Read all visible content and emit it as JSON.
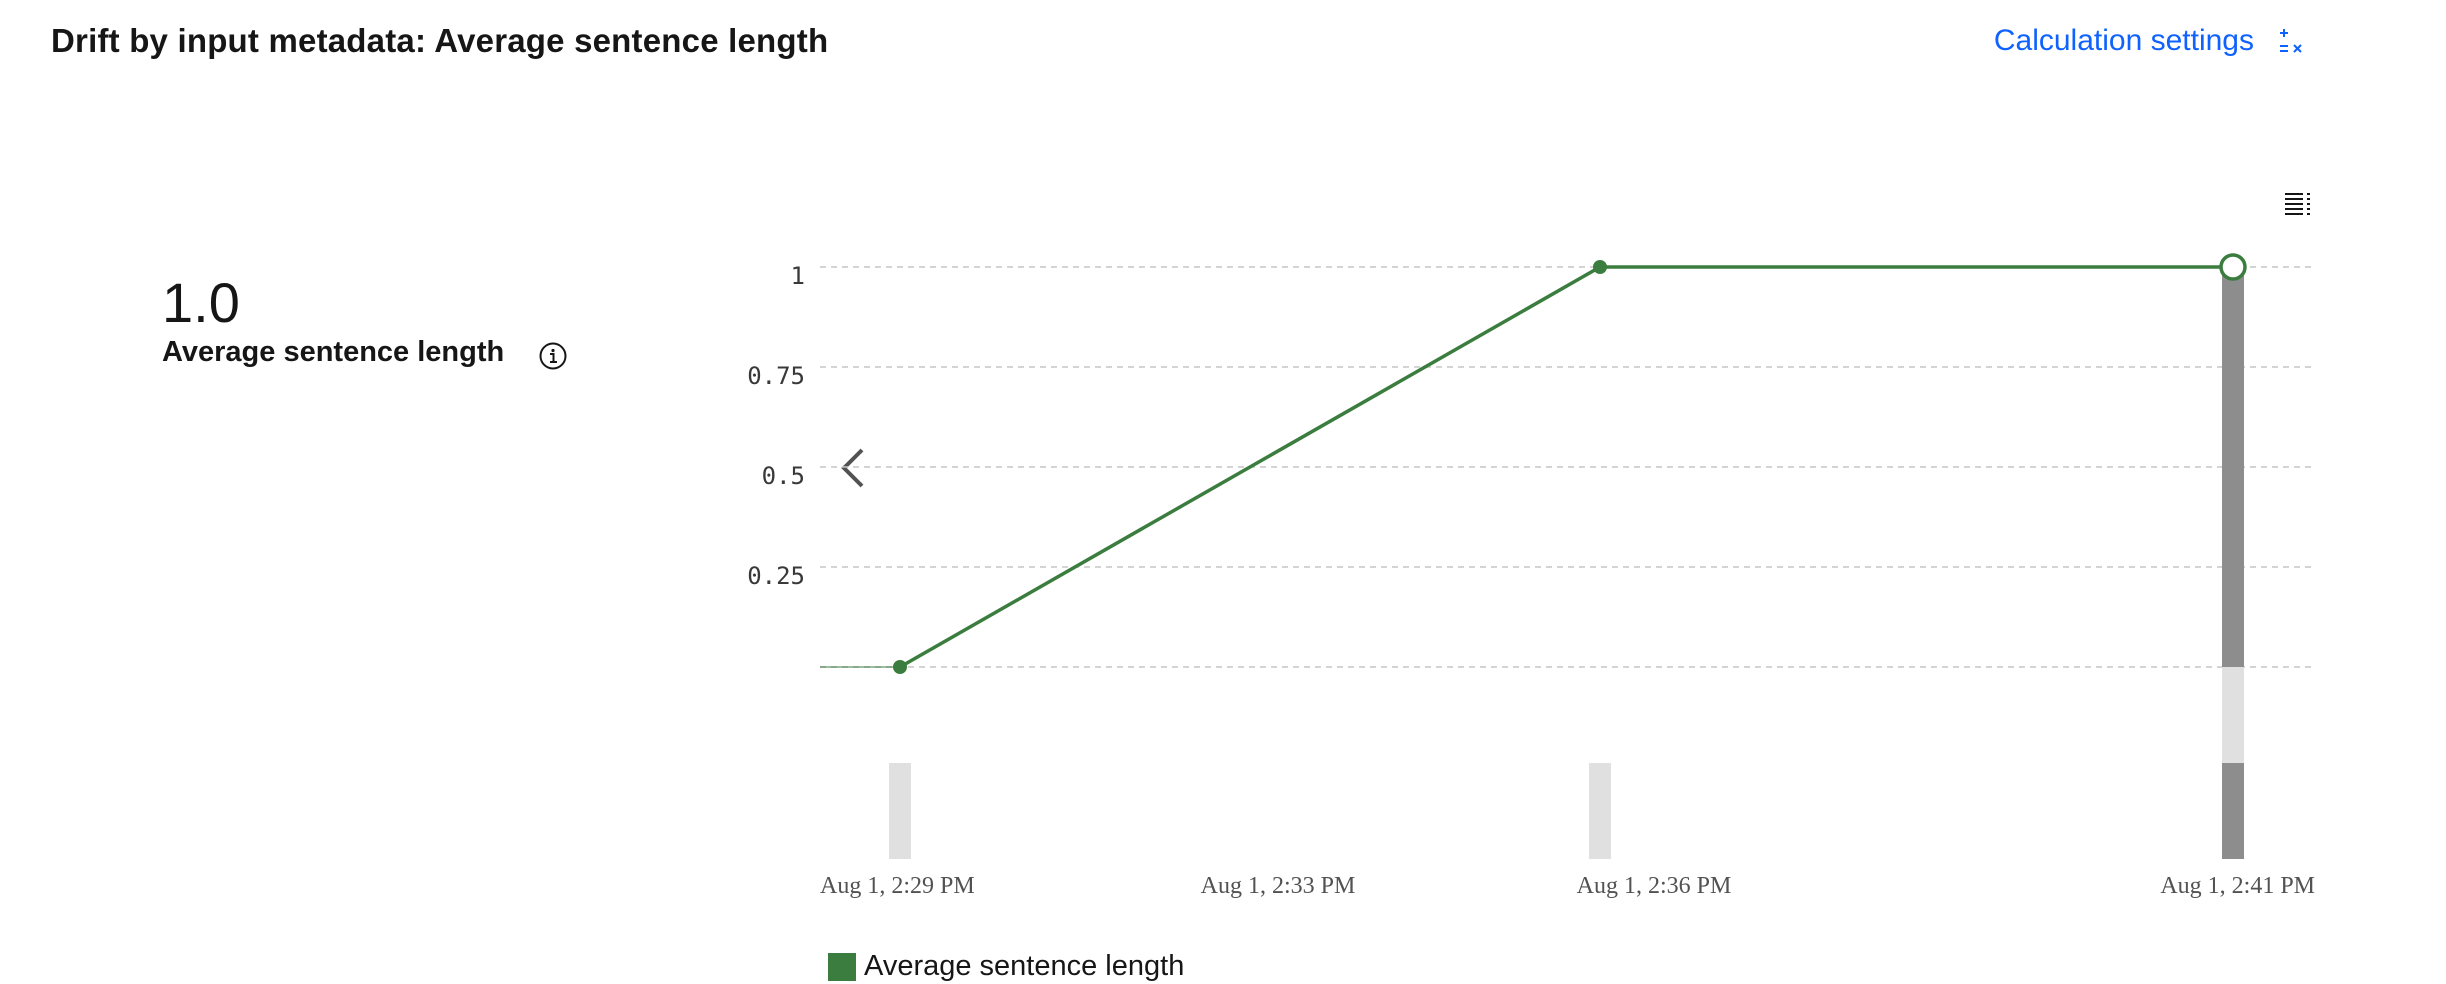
{
  "header": {
    "title": "Drift by input metadata: Average sentence length",
    "calc_settings_label": "Calculation settings"
  },
  "metric": {
    "value": "1.0",
    "label": "Average sentence length"
  },
  "icons": {
    "calc": "calculator-icon",
    "info": "info-icon",
    "table": "table-view-icon",
    "prev": "chevron-left-icon"
  },
  "colors": {
    "accent": "#0f62fe",
    "series": "#3b7d3e",
    "bar": "#8d8d8d",
    "bar_light": "#e0e0e0"
  },
  "chart_data": {
    "type": "line",
    "title": "",
    "xlabel": "",
    "ylabel": "",
    "ylim": [
      0,
      1
    ],
    "yticks": [
      0,
      0.25,
      0.5,
      0.75,
      1
    ],
    "ytick_labels": [
      "",
      "0.25",
      "0.5",
      "0.75",
      "1"
    ],
    "x_ticks": [
      "Aug 1, 2:29 PM",
      "Aug 1, 2:33 PM",
      "Aug 1, 2:36 PM",
      "Aug 1, 2:41 PM"
    ],
    "grid": true,
    "legend": "bottom-left",
    "series": [
      {
        "name": "Average sentence length",
        "points": [
          {
            "x": "Aug 1, 2:29 PM",
            "y": 0
          },
          {
            "x": "Aug 1, 2:36 PM",
            "y": 1
          },
          {
            "x": "Aug 1, 2:41 PM",
            "y": 1
          }
        ]
      }
    ],
    "selected_point": "Aug 1, 2:41 PM"
  }
}
